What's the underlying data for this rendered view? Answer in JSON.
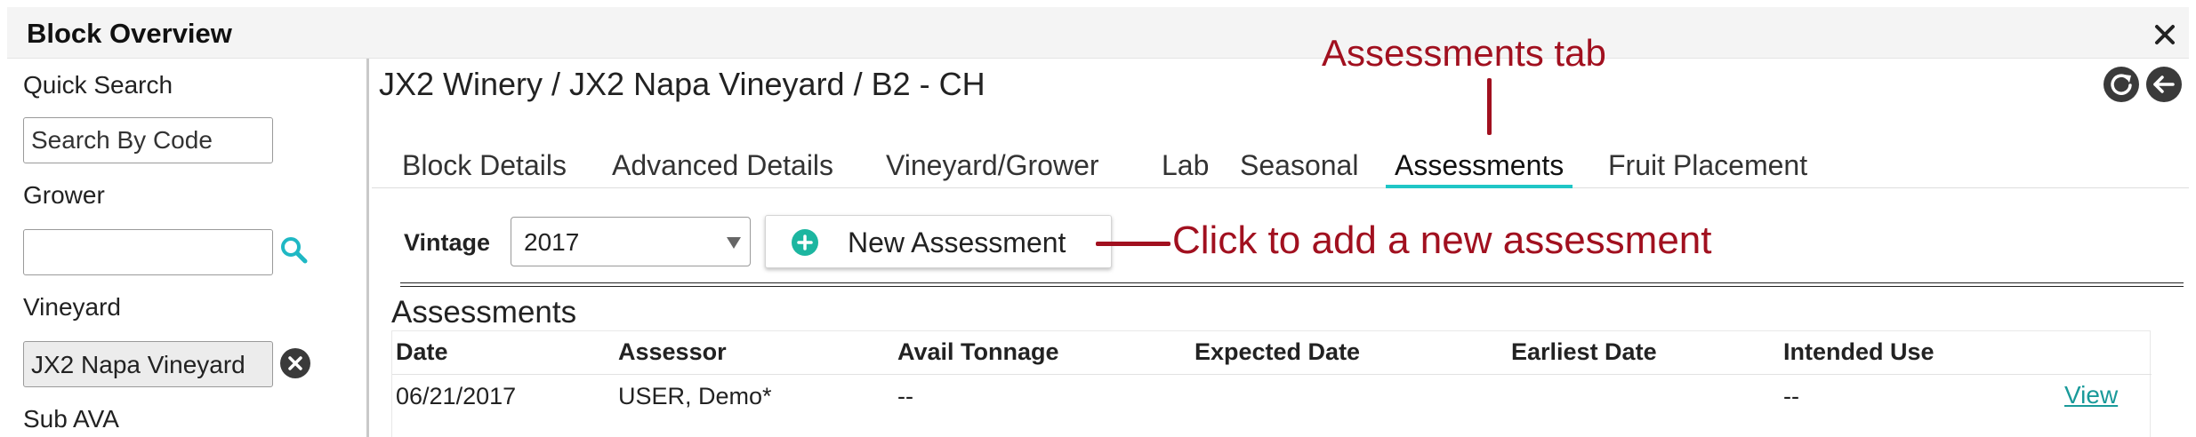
{
  "window": {
    "title": "Block Overview",
    "close_glyph": "×"
  },
  "sidebar": {
    "quick_search_label": "Quick Search",
    "quick_search_placeholder": "Search By Code",
    "grower_label": "Grower",
    "grower_value": "",
    "vineyard_label": "Vineyard",
    "vineyard_value": "JX2 Napa Vineyard",
    "sub_ava_label": "Sub AVA"
  },
  "header": {
    "breadcrumb": "JX2 Winery / JX2 Napa Vineyard / B2 - CH",
    "icons": [
      "refresh-icon",
      "back-arrow-icon"
    ]
  },
  "tabs": [
    {
      "label": "Block Details",
      "active": false
    },
    {
      "label": "Advanced Details",
      "active": false
    },
    {
      "label": "Vineyard/Grower",
      "active": false
    },
    {
      "label": "Lab",
      "active": false
    },
    {
      "label": "Seasonal",
      "active": false
    },
    {
      "label": "Assessments",
      "active": true
    },
    {
      "label": "Fruit Placement",
      "active": false
    }
  ],
  "toolbar": {
    "vintage_label": "Vintage",
    "vintage_value": "2017",
    "new_assessment_label": "New Assessment"
  },
  "assessments": {
    "title": "Assessments",
    "columns": [
      "Date",
      "Assessor",
      "Avail Tonnage",
      "Expected Date",
      "Earliest Date",
      "Intended Use"
    ],
    "rows": [
      {
        "date": "06/21/2017",
        "assessor": "USER, Demo*",
        "avail_tonnage": "--",
        "expected_date": "",
        "earliest_date": "",
        "intended_use": "--",
        "action": "View"
      }
    ]
  },
  "annotations": {
    "tab_note": "Assessments tab",
    "button_note": "Click to add a new assessment"
  },
  "colors": {
    "accent_teal": "#1fc6c6",
    "add_icon_green": "#1cb6a0",
    "annotation_red": "#a1101f",
    "link_teal": "#1a9a9a"
  }
}
